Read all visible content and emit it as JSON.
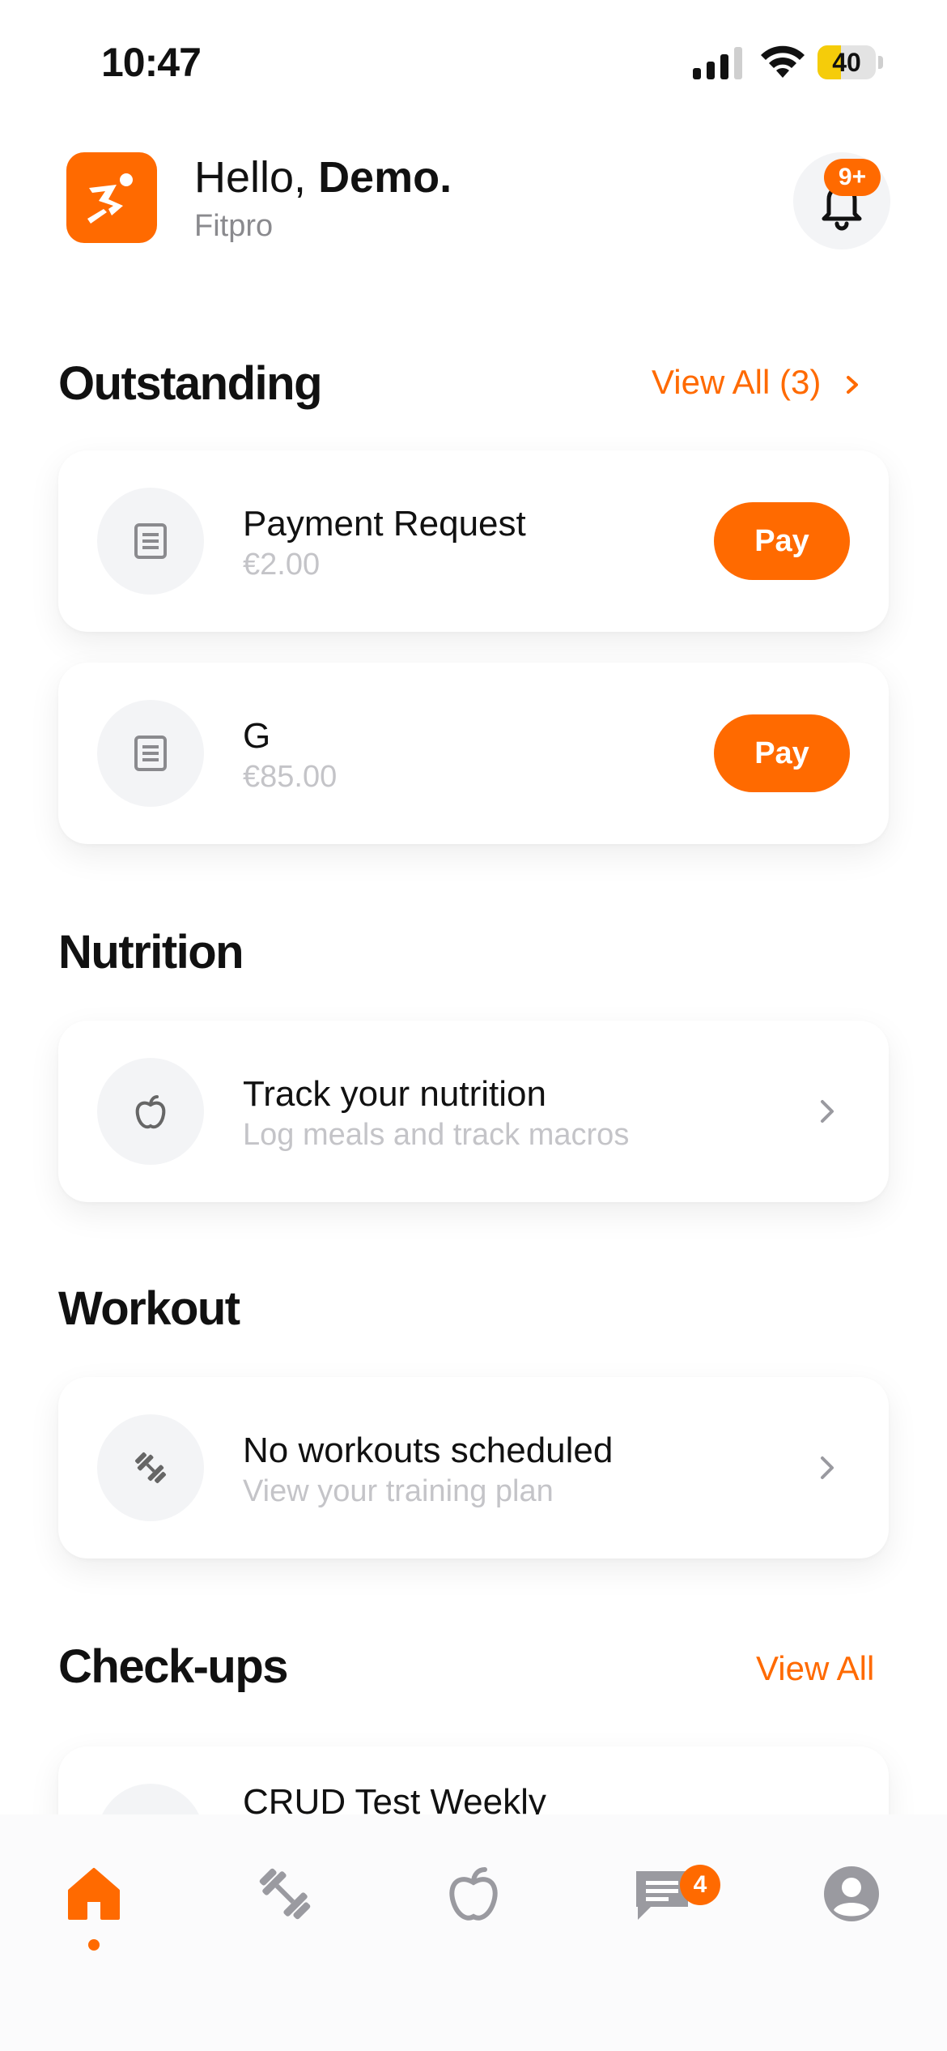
{
  "status_bar": {
    "time": "10:47",
    "battery": "40",
    "battery_level": 0.4
  },
  "header": {
    "greeting_prefix": "Hello, ",
    "user_name": "Demo.",
    "brand": "Fitpro",
    "notification_badge": "9+"
  },
  "outstanding": {
    "title": "Outstanding",
    "view_all": "View All (3)",
    "items": [
      {
        "title": "Payment Request",
        "amount": "€2.00",
        "action": "Pay",
        "icon": "receipt-icon"
      },
      {
        "title": "G",
        "amount": "€85.00",
        "action": "Pay",
        "icon": "receipt-icon"
      }
    ]
  },
  "nutrition": {
    "title": "Nutrition",
    "card_title": "Track your nutrition",
    "card_sub": "Log meals and track macros",
    "icon": "apple-icon"
  },
  "workout": {
    "title": "Workout",
    "card_title": "No workouts scheduled",
    "card_sub": "View your training plan",
    "icon": "dumbbell-icon"
  },
  "checkups": {
    "title": "Check-ups",
    "view_all": "View All",
    "partial_item": "CRUD Test Weekly"
  },
  "tabbar": {
    "tabs": [
      "home-icon",
      "dumbbell-icon",
      "apple-icon",
      "chat-icon",
      "profile-icon"
    ],
    "messages_badge": "4"
  },
  "colors": {
    "accent": "#ff6a00",
    "muted": "#8a8a8e",
    "subtle": "#c4c4c8"
  }
}
